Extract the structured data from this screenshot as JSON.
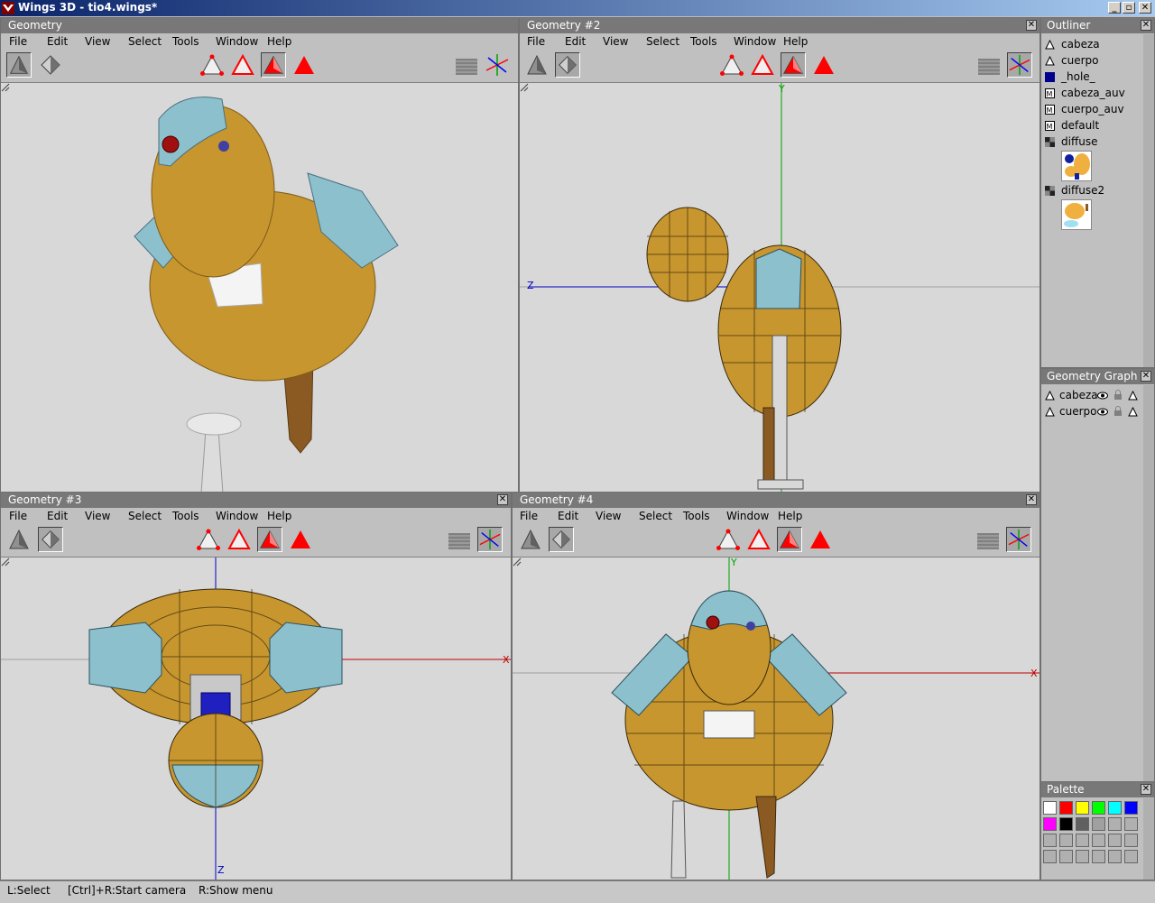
{
  "app": {
    "title": "Wings 3D - tio4.wings*"
  },
  "menus": [
    "File",
    "Edit",
    "View",
    "Select",
    "Tools",
    "Window",
    "Help"
  ],
  "viewports": {
    "v1": {
      "title": "Geometry"
    },
    "v2": {
      "title": "Geometry #2",
      "axis_y": "Y",
      "axis_z": "Z"
    },
    "v3": {
      "title": "Geometry #3",
      "axis_x": "X",
      "axis_z": "Z"
    },
    "v4": {
      "title": "Geometry #4",
      "axis_y": "Y",
      "axis_x": "X"
    }
  },
  "outliner": {
    "title": "Outliner",
    "items": [
      {
        "label": "cabeza",
        "icon": "object-icon"
      },
      {
        "label": "cuerpo",
        "icon": "object-icon"
      },
      {
        "label": "_hole_",
        "icon": "material-swatch-icon"
      },
      {
        "label": "cabeza_auv",
        "icon": "material-icon"
      },
      {
        "label": "cuerpo_auv",
        "icon": "material-icon"
      },
      {
        "label": "default",
        "icon": "material-icon"
      },
      {
        "label": "diffuse",
        "icon": "image-icon"
      },
      {
        "label": "diffuse2",
        "icon": "image-icon"
      }
    ]
  },
  "geometry_graph": {
    "title": "Geometry Graph",
    "items": [
      {
        "label": "cabeza"
      },
      {
        "label": "cuerpo"
      }
    ]
  },
  "palette": {
    "title": "Palette",
    "colors": [
      "#ffffff",
      "#ff0000",
      "#ffff00",
      "#00ff00",
      "#00ffff",
      "#0000ff",
      "#ff00ff",
      "#000000",
      "#606060",
      "#a0a0a0"
    ]
  },
  "status": {
    "left": "L:Select",
    "middle": "[Ctrl]+R:Start camera",
    "right": "R:Show menu"
  },
  "colors": {
    "title_bar": "#787878",
    "viewport_bg": "#d8d8d8",
    "body_fill": "#c8962e",
    "armor_fill": "#8cc0cc",
    "select_red": "#ff0000"
  }
}
